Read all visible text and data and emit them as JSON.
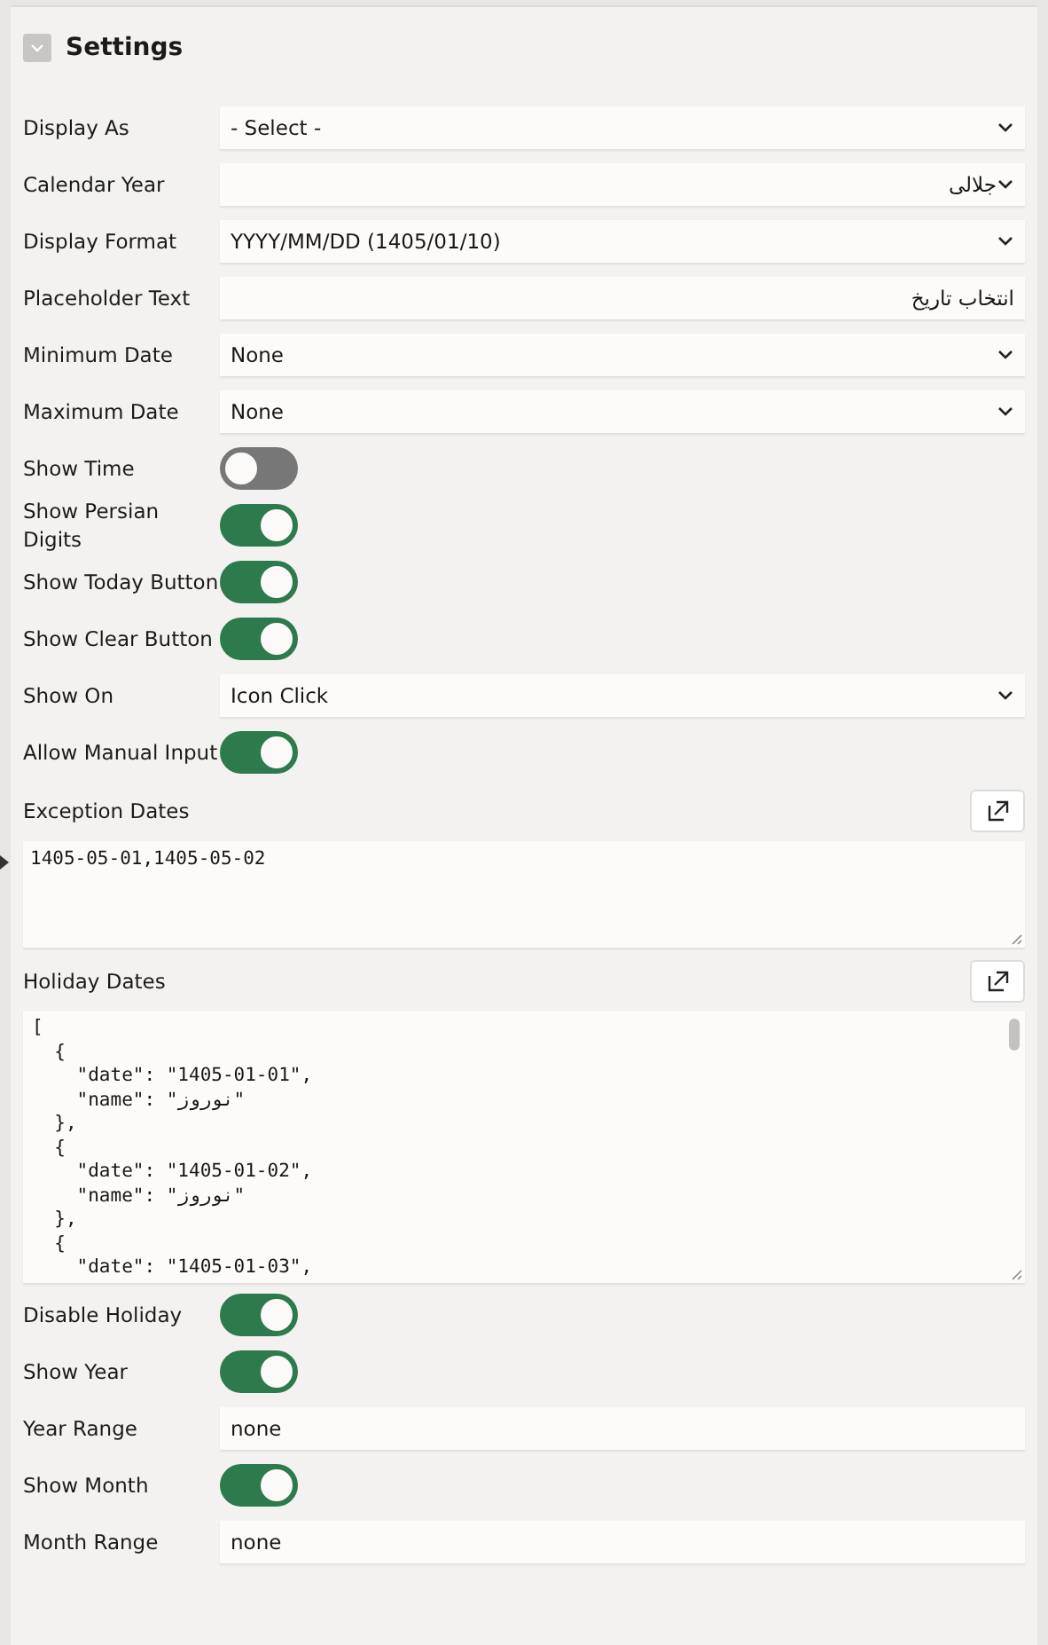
{
  "section": {
    "title": "Settings",
    "expanded": true
  },
  "fields": [
    {
      "kind": "select",
      "label": "Display As",
      "value": "- Select -"
    },
    {
      "kind": "select",
      "label": "Calendar Year",
      "value": "جلالی"
    },
    {
      "kind": "select",
      "label": "Display Format",
      "value": "YYYY/MM/DD (1405/01/10)"
    },
    {
      "kind": "text",
      "label": "Placeholder Text",
      "value": "انتخاب تاریخ"
    },
    {
      "kind": "select",
      "label": "Minimum Date",
      "value": "None"
    },
    {
      "kind": "select",
      "label": "Maximum Date",
      "value": "None"
    },
    {
      "kind": "switch",
      "label": "Show Time",
      "on": false
    },
    {
      "kind": "switch",
      "label": "Show Persian Digits",
      "on": true
    },
    {
      "kind": "switch",
      "label": "Show Today Button",
      "on": true
    },
    {
      "kind": "switch",
      "label": "Show Clear Button",
      "on": true
    },
    {
      "kind": "select",
      "label": "Show On",
      "value": "Icon Click"
    },
    {
      "kind": "switch",
      "label": "Allow Manual Input",
      "on": true
    },
    {
      "kind": "textarea",
      "label": "Exception Dates",
      "value": "1405-05-01,1405-05-02"
    },
    {
      "kind": "code",
      "label": "Holiday Dates",
      "value": "[\n  {\n    \"date\": \"1405-01-01\",\n    \"name\": \"نوروز\"\n  },\n  {\n    \"date\": \"1405-01-02\",\n    \"name\": \"نوروز\"\n  },\n  {\n    \"date\": \"1405-01-03\","
    },
    {
      "kind": "switch",
      "label": "Disable Holiday",
      "on": true
    },
    {
      "kind": "switch",
      "label": "Show Year",
      "on": true
    },
    {
      "kind": "text",
      "label": "Year Range",
      "value": "none"
    },
    {
      "kind": "switch",
      "label": "Show Month",
      "on": true
    },
    {
      "kind": "text",
      "label": "Month Range",
      "value": "none"
    }
  ]
}
